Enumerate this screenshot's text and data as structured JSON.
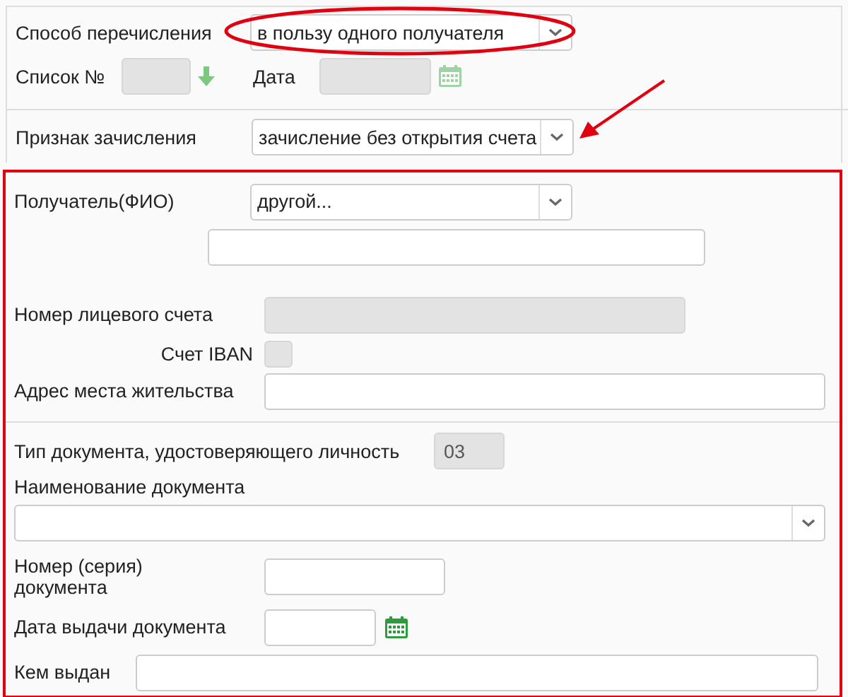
{
  "transfer_method": {
    "label": "Способ перечисления",
    "value": "в пользу одного получателя",
    "highlighted": true
  },
  "list_number": {
    "label": "Список №",
    "disabled": true
  },
  "date": {
    "label": "Дата",
    "disabled": true
  },
  "credit_attribute": {
    "label": "Признак зачисления",
    "value": "зачисление без открытия счета",
    "highlighted": true
  },
  "recipient_section": {
    "highlighted": true,
    "recipient": {
      "label": "Получатель(ФИО)",
      "value": "другой..."
    },
    "recipient_name": {
      "disabled": false
    },
    "account_number": {
      "label": "Номер лицевого счета",
      "disabled": true
    },
    "iban": {
      "label": "Счет IBAN",
      "checked": false,
      "disabled": true
    },
    "address": {
      "label": "Адрес места жительства",
      "disabled": false
    },
    "doc_type": {
      "label": "Тип документа, удостоверяющего личность",
      "value": "03",
      "disabled": true
    },
    "doc_name": {
      "label": "Наименование документа"
    },
    "doc_number": {
      "label": "Номер (серия) документа",
      "disabled": false
    },
    "issue_date": {
      "label": "Дата выдачи документа",
      "disabled": false
    },
    "issued_by": {
      "label": "Кем выдан",
      "disabled": false
    }
  }
}
